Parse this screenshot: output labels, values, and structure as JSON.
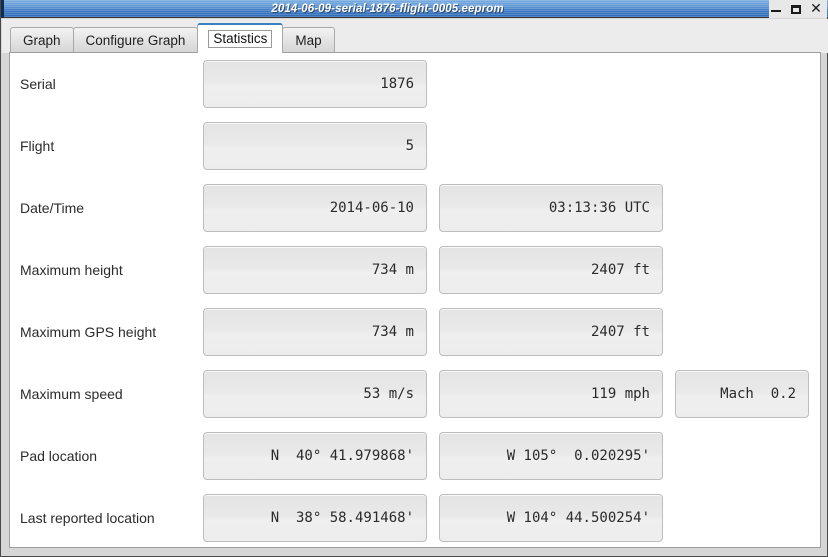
{
  "window": {
    "title": "2014-06-09-serial-1876-flight-0005.eeprom",
    "controls": {
      "minimize": "minimize-icon",
      "maximize": "maximize-icon",
      "close": "close-icon"
    }
  },
  "tabs": [
    {
      "label": "Graph",
      "active": false
    },
    {
      "label": "Configure Graph",
      "active": false
    },
    {
      "label": "Statistics",
      "active": true
    },
    {
      "label": "Map",
      "active": false
    }
  ],
  "statistics": {
    "rows": [
      {
        "label": "Serial",
        "values": [
          "1876"
        ]
      },
      {
        "label": "Flight",
        "values": [
          "5"
        ]
      },
      {
        "label": "Date/Time",
        "values": [
          "2014-06-10",
          "03:13:36 UTC"
        ]
      },
      {
        "label": "Maximum height",
        "values": [
          "734 m",
          "2407 ft"
        ]
      },
      {
        "label": "Maximum GPS height",
        "values": [
          "734 m",
          "2407 ft"
        ]
      },
      {
        "label": "Maximum speed",
        "values": [
          "53 m/s",
          "119 mph",
          "Mach  0.2"
        ]
      },
      {
        "label": "Pad location",
        "values": [
          "N  40° 41.979868'",
          "W 105°  0.020295'"
        ]
      },
      {
        "label": "Last reported location",
        "values": [
          "N  38° 58.491468'",
          "W 104° 44.500254'"
        ]
      }
    ]
  },
  "colors": {
    "titlebar_blue": "#3f7bc4",
    "tab_active_accent": "#3d7fc1",
    "panel_background": "#ffffff",
    "field_background": "#ebebeb"
  }
}
